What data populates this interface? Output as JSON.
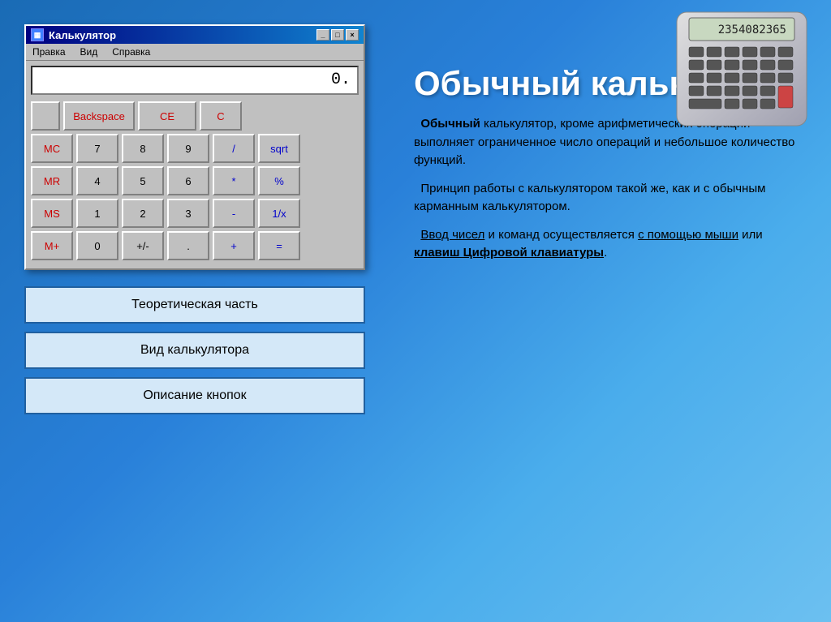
{
  "window": {
    "title": "Калькулятор",
    "menu": [
      "Правка",
      "Вид",
      "Справка"
    ],
    "display_value": "0.",
    "title_close": "×",
    "title_max": "□",
    "title_min": "_"
  },
  "calculator": {
    "rows": [
      [
        {
          "label": "",
          "type": "checkbox"
        },
        {
          "label": "Backspace",
          "type": "backspace"
        },
        {
          "label": "CE",
          "type": "ce"
        },
        {
          "label": "C",
          "type": "c"
        }
      ],
      [
        {
          "label": "MC",
          "type": "memory"
        },
        {
          "label": "7",
          "type": "digit"
        },
        {
          "label": "8",
          "type": "digit"
        },
        {
          "label": "9",
          "type": "digit"
        },
        {
          "label": "/",
          "type": "op"
        },
        {
          "label": "sqrt",
          "type": "op"
        }
      ],
      [
        {
          "label": "MR",
          "type": "memory"
        },
        {
          "label": "4",
          "type": "digit"
        },
        {
          "label": "5",
          "type": "digit"
        },
        {
          "label": "6",
          "type": "digit"
        },
        {
          "label": "*",
          "type": "op"
        },
        {
          "label": "%",
          "type": "op"
        }
      ],
      [
        {
          "label": "MS",
          "type": "memory"
        },
        {
          "label": "1",
          "type": "digit"
        },
        {
          "label": "2",
          "type": "digit"
        },
        {
          "label": "3",
          "type": "digit"
        },
        {
          "label": "-",
          "type": "op"
        },
        {
          "label": "1/x",
          "type": "op"
        }
      ],
      [
        {
          "label": "M+",
          "type": "memory"
        },
        {
          "label": "0",
          "type": "digit"
        },
        {
          "label": "+/-",
          "type": "digit"
        },
        {
          "label": ".",
          "type": "digit"
        },
        {
          "label": "+",
          "type": "op"
        },
        {
          "label": "=",
          "type": "eq"
        }
      ]
    ]
  },
  "nav": {
    "buttons": [
      "Теоретическая часть",
      "Вид калькулятора",
      "Описание кнопок"
    ]
  },
  "heading": "Обычный калькулятор",
  "content": {
    "para1_bold": "Обычный",
    "para1_rest": " калькулятор, кроме арифметических операций выполняет ограниченное число операций и небольшое количество функций.",
    "para2": "Принцип работы с калькулятором такой же, как и с обычным карманным калькулятором.",
    "para3_1": "Ввод чисел",
    "para3_2": " и команд осуществляется ",
    "para3_3": "с помощью мыши",
    "para3_4": " или ",
    "para3_5": "клавиш Цифровой клавиатуры",
    "para3_6": "."
  }
}
